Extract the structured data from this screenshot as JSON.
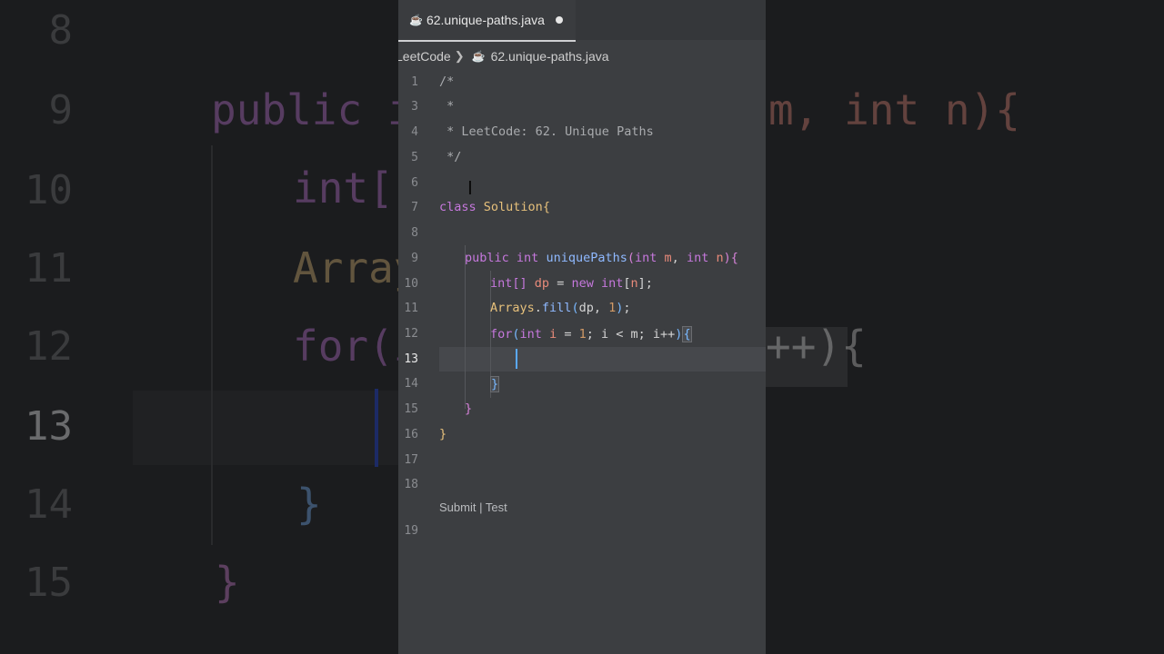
{
  "tab": {
    "filename": "62.unique-paths.java",
    "icon": "java-file-icon",
    "modified": true
  },
  "breadcrumb": {
    "folder": "LeetCode",
    "file": "62.unique-paths.java"
  },
  "editor": {
    "line_numbers": [
      "1",
      "3",
      "4",
      "5",
      "6",
      "7",
      "8",
      "9",
      "10",
      "11",
      "12",
      "13",
      "14",
      "15",
      "16",
      "17",
      "18",
      "19"
    ],
    "active_line": "13",
    "lines": {
      "l1": "/*",
      "l3": " *",
      "l4": " * LeetCode: 62. Unique Paths",
      "l5": " */",
      "l7_kw": "class",
      "l7_name": "Solution",
      "l9_public": "public",
      "l9_int": "int",
      "l9_fn": "uniquePaths",
      "l9_int2": "int",
      "l9_m": "m",
      "l9_int3": "int",
      "l9_n": "n",
      "l10_type": "int[]",
      "l10_var": "dp",
      "l10_eq": "=",
      "l10_new": "new",
      "l10_int": "int",
      "l10_n": "n",
      "l11_cls": "Arrays",
      "l11_fn": "fill",
      "l11_args": "dp, ",
      "l11_num": "1",
      "l12_for": "for",
      "l12_int": "int",
      "l12_i": "i",
      "l12_num": "1",
      "l12_rest": "; i < m; i++"
    },
    "codelens": {
      "submit": "Submit",
      "separator": " | ",
      "test": "Test"
    }
  },
  "background_zoom": {
    "line_numbers": [
      "8",
      "9",
      "10",
      "11",
      "12",
      "13",
      "14",
      "15"
    ],
    "snippets": {
      "s9a": "public int",
      "s9b": "m, int n){",
      "s10": "int[]",
      "s11": "Array",
      "s12a": "for(i",
      "s12b": "++){",
      "s14": "}",
      "s15": "}"
    }
  },
  "colors": {
    "keyword": "#c678dd",
    "class": "#e6c07b",
    "function": "#8fb9ff",
    "variable": "#e88a7a",
    "caret": "#5aa9ff"
  }
}
